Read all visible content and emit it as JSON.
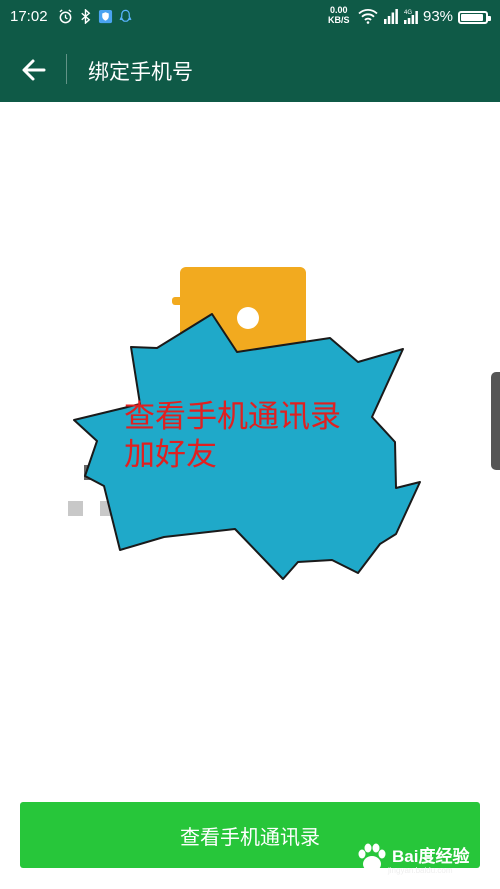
{
  "status_bar": {
    "time": "17:02",
    "net_speed_value": "0.00",
    "net_speed_unit": "KB/S",
    "battery_percent": "93%",
    "battery_level": 0.93,
    "icons_left": [
      "alarm-icon",
      "bluetooth-icon",
      "shield-icon",
      "qq-icon"
    ],
    "icons_right": [
      "wifi-icon",
      "signal-icon",
      "signal-4g-icon"
    ]
  },
  "header": {
    "title": "绑定手机号",
    "background": "#0f5a47"
  },
  "illustration": {
    "burst_line1": "查看手机通讯录",
    "burst_line2": "加好友",
    "burst_color": "#1fa9c9",
    "text_color": "#e02020",
    "phone_color": "#f2aa1f"
  },
  "footer": {
    "button_label": "查看手机通讯录",
    "button_color": "#27c63a"
  },
  "watermark": {
    "brand": "Bai度经验",
    "url": "jingyan.baidu.com"
  }
}
